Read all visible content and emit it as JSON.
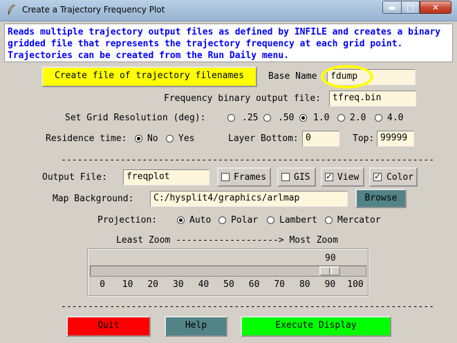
{
  "window": {
    "title": "Create a Trajectory Frequency Plot",
    "minimize": "▬",
    "maximize": "□",
    "close": "✕"
  },
  "description": "Reads multiple trajectory output files as defined by INFILE and creates a binary\ngridded file that represents the trajectory frequency at each grid point.\nTrajectories can be created from the Run Daily menu.",
  "create_file_button": "Create file of trajectory filenames",
  "base_name": {
    "label": "Base Name",
    "value": "fdump"
  },
  "freq_output": {
    "label": "Frequency binary output file:",
    "value": "tfreq.bin"
  },
  "grid_resolution": {
    "label": "Set Grid Resolution (deg):",
    "options": [
      ".25",
      ".50",
      "1.0",
      "2.0",
      "4.0"
    ],
    "selected": "1.0"
  },
  "residence_time": {
    "label": "Residence time:",
    "options": [
      "No",
      "Yes"
    ],
    "selected": "No"
  },
  "layer_bottom": {
    "label": "Layer Bottom:",
    "value": "0"
  },
  "top": {
    "label": "Top:",
    "value": "99999"
  },
  "separator": "------------------------------------------------------------------------------",
  "output_file": {
    "label": "Output File:",
    "value": "freqplot"
  },
  "checkboxes": {
    "frames": {
      "label": "Frames",
      "checked": false
    },
    "gis": {
      "label": "GIS",
      "checked": false
    },
    "view": {
      "label": "View",
      "checked": true
    },
    "color": {
      "label": "Color",
      "checked": true
    }
  },
  "map_background": {
    "label": "Map Background:",
    "value": "C:/hysplit4/graphics/arlmap",
    "browse": "Browse"
  },
  "projection": {
    "label": "Projection:",
    "options": [
      "Auto",
      "Polar",
      "Lambert",
      "Mercator"
    ],
    "selected": "Auto"
  },
  "zoom": {
    "caption": "Least Zoom -------------------> Most Zoom",
    "value": 90,
    "value_label": "90",
    "ticks": [
      "0",
      "10",
      "20",
      "30",
      "40",
      "50",
      "60",
      "70",
      "80",
      "90",
      "100"
    ]
  },
  "buttons": {
    "quit": "Quit",
    "help": "Help",
    "execute": "Execute Display"
  },
  "colors": {
    "create_button": "#ffff00",
    "quit": "#ff0000",
    "help": "#528387",
    "execute": "#00ff00",
    "browse": "#528387",
    "description_text": "#0000ff",
    "highlight": "#ffff00"
  }
}
